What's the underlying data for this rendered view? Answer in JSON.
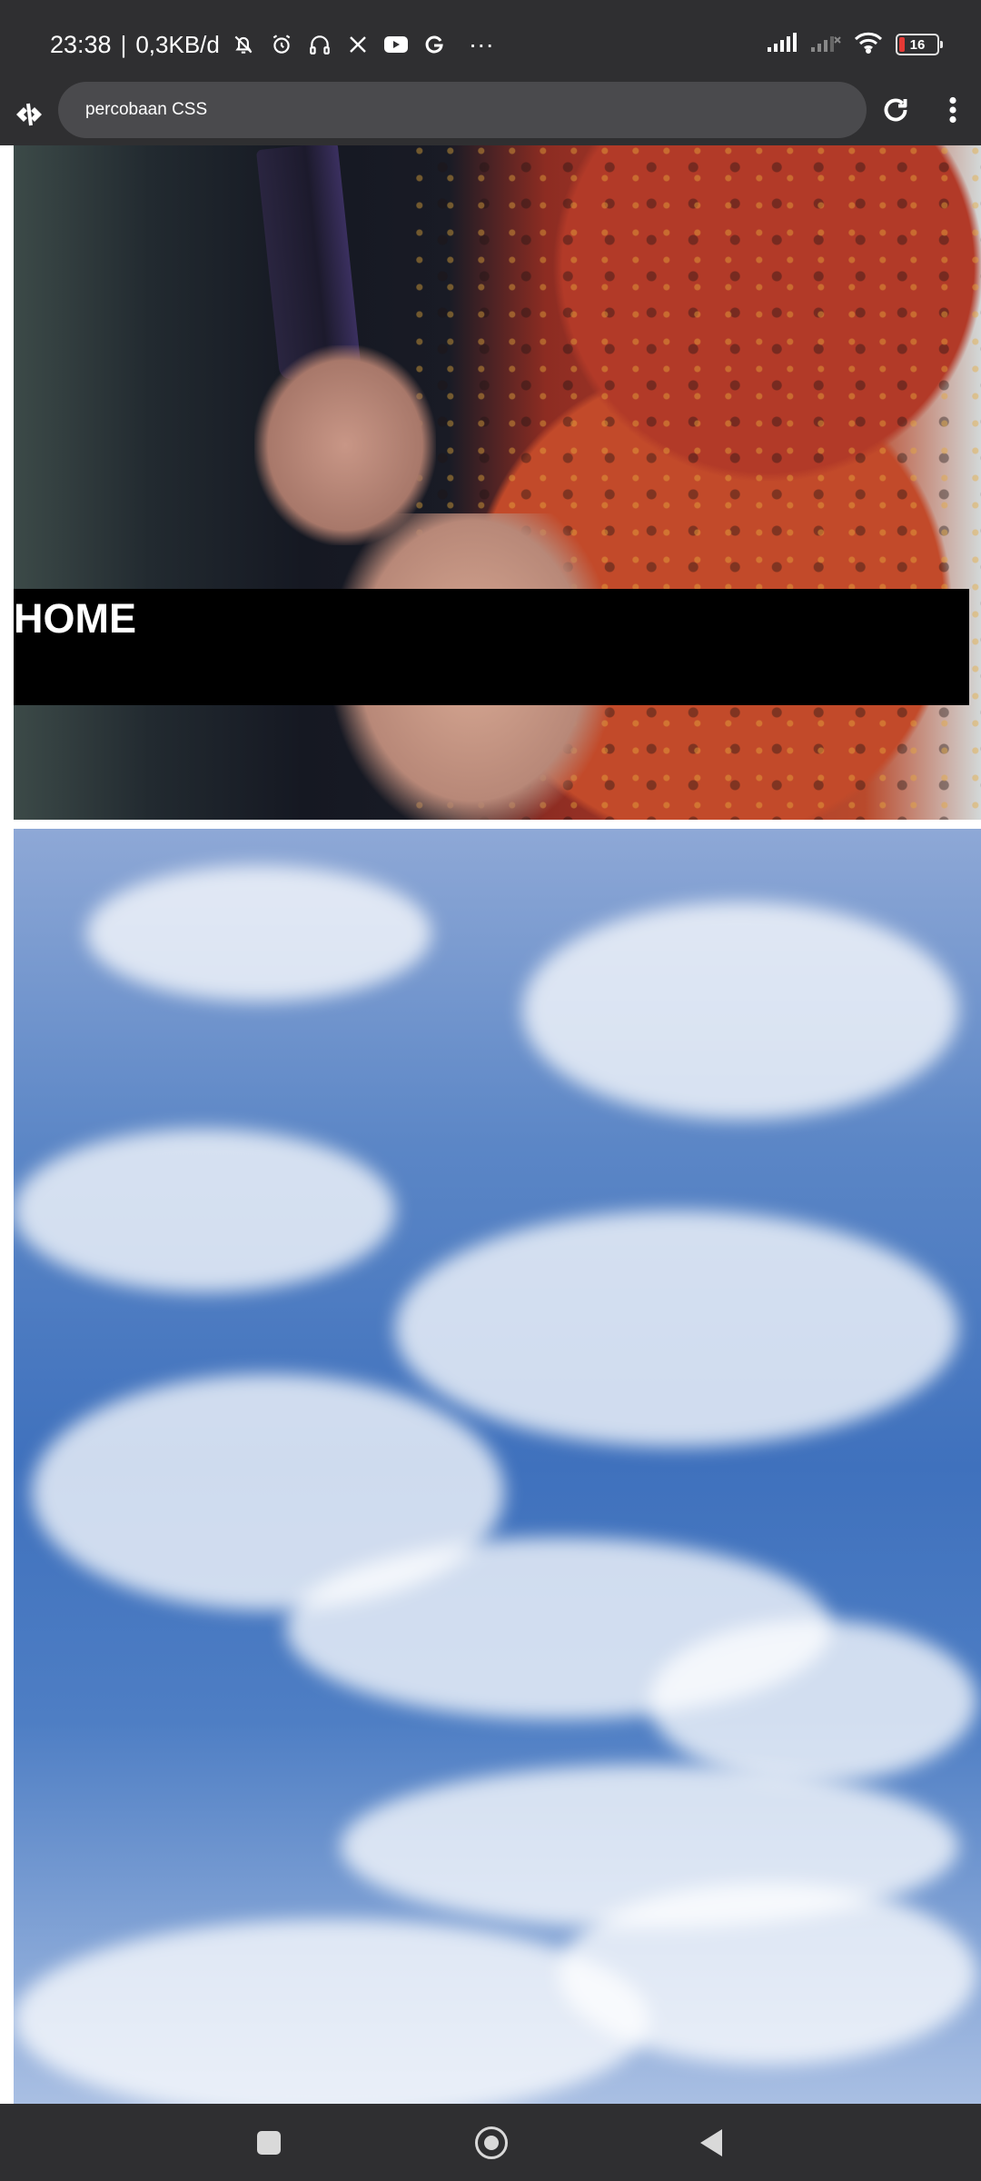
{
  "status_bar": {
    "time": "23:38",
    "separator": "|",
    "data_rate": "0,3KB/d",
    "overflow_indicator": "···",
    "battery_level": "16",
    "battery_fraction": 0.16,
    "icons": [
      "bell-off-icon",
      "alarm-icon",
      "headphones-icon",
      "x-logo-icon",
      "youtube-icon",
      "google-icon",
      "signal-icon",
      "signal-weak-icon",
      "wifi-icon",
      "battery-icon"
    ]
  },
  "browser": {
    "url_text": "percobaan CSS",
    "icons": [
      "app-logo-icon",
      "reload-icon",
      "more-vert-icon"
    ]
  },
  "page": {
    "home_title": "HOME"
  },
  "colors": {
    "system_bar": "#2f2f31",
    "url_bar": "#4a4a4d",
    "banner": "#000000",
    "battery_low": "#e53935"
  }
}
